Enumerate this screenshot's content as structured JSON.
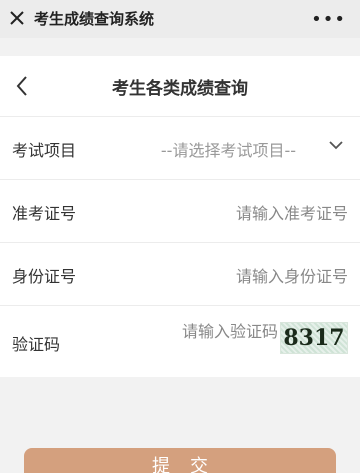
{
  "titlebar": {
    "title": "考生成绩查询系统",
    "more": "•••"
  },
  "header": {
    "title": "考生各类成绩查询"
  },
  "form": {
    "exam_project_label": "考试项目",
    "exam_project_placeholder": "--请选择考试项目--",
    "ticket_label": "准考证号",
    "ticket_placeholder": "请输入准考证号",
    "id_label": "身份证号",
    "id_placeholder": "请输入身份证号",
    "captcha_label": "验证码",
    "captcha_placeholder": "请输入验证码",
    "captcha_code": "8317"
  },
  "submit_label": "提交"
}
